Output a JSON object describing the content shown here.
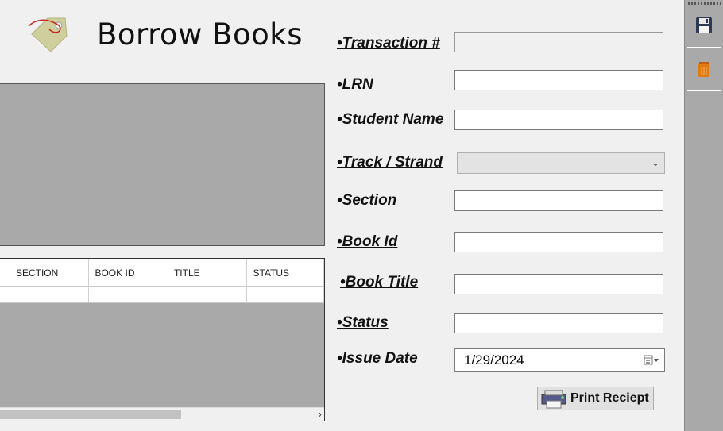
{
  "header": {
    "title": "Borrow Books",
    "icon": "tag-icon"
  },
  "form": {
    "transaction_label": "•Transaction #",
    "transaction_value": "",
    "lrn_label": "•LRN",
    "lrn_value": "",
    "student_name_label": "•Student Name",
    "student_name_value": "",
    "track_strand_label": "•Track / Strand",
    "track_strand_value": "",
    "section_label": "•Section",
    "section_value": "",
    "book_id_label": "•Book Id",
    "book_id_value": "",
    "book_title_label": "•Book Title",
    "book_title_value": "",
    "status_label": "•Status",
    "status_value": "",
    "issue_date_label": "•Issue Date",
    "issue_date_value": "1/29/2024"
  },
  "grid": {
    "columns": [
      "SECTION",
      "BOOK ID",
      "TITLE",
      "STATUS"
    ],
    "rows": [
      [
        "",
        "",
        "",
        ""
      ]
    ]
  },
  "toolbar": {
    "save_icon": "save-icon",
    "delete_icon": "trash-icon"
  },
  "actions": {
    "print_label": "Print Reciept"
  },
  "colors": {
    "panel_gray": "#a9a9a9",
    "trash_orange": "#e07a12",
    "tag_color": "#c8c89a"
  }
}
